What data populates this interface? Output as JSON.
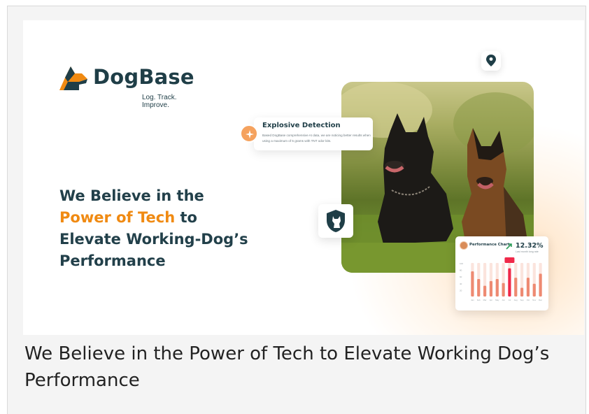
{
  "brand": {
    "name": "DogBase",
    "tagline": "Log. Track. Improve.",
    "colors": {
      "primary": "#1f3e47",
      "accent": "#f08a12"
    }
  },
  "headline": {
    "line1": "We Believe in the",
    "accent": "Power of Tech",
    "accent_suffix": " to",
    "line3": "Elevate Working-Dog’s",
    "line4": "Performance"
  },
  "detection_card": {
    "icon": "sparkle-icon",
    "title": "Explosive Detection",
    "body": "Based DogBase comprehensive AI data, we are noticing better results when using a maximum of 5 grams with TNT odor kits."
  },
  "map_pin": {
    "icon": "map-pin-icon"
  },
  "shield_card": {
    "icon": "dog-shield-icon"
  },
  "performance_card": {
    "title": "Performance Chart",
    "value": "12.32%",
    "trend_icon": "trend-up-icon",
    "subtitle": "Last month long rate"
  },
  "chart_data": {
    "type": "bar",
    "categories": [
      "Jan",
      "Feb",
      "Mar",
      "Apr",
      "May",
      "Jun",
      "Jul",
      "Aug",
      "Sep",
      "Oct",
      "Nov",
      "Dec"
    ],
    "values": [
      75,
      52,
      32,
      46,
      52,
      40,
      84,
      56,
      26,
      56,
      38,
      68
    ],
    "highlight_index": 6,
    "highlight_label": "",
    "yticks": [
      "100",
      "80",
      "60",
      "40",
      "20"
    ],
    "ylim": [
      0,
      100
    ],
    "bar_color": "#ee8a72",
    "track_color": "#fbe4dd",
    "highlight_color": "#f0294a"
  },
  "caption": "We Believe in the Power of Tech to Elevate Working Dog’s Performance"
}
